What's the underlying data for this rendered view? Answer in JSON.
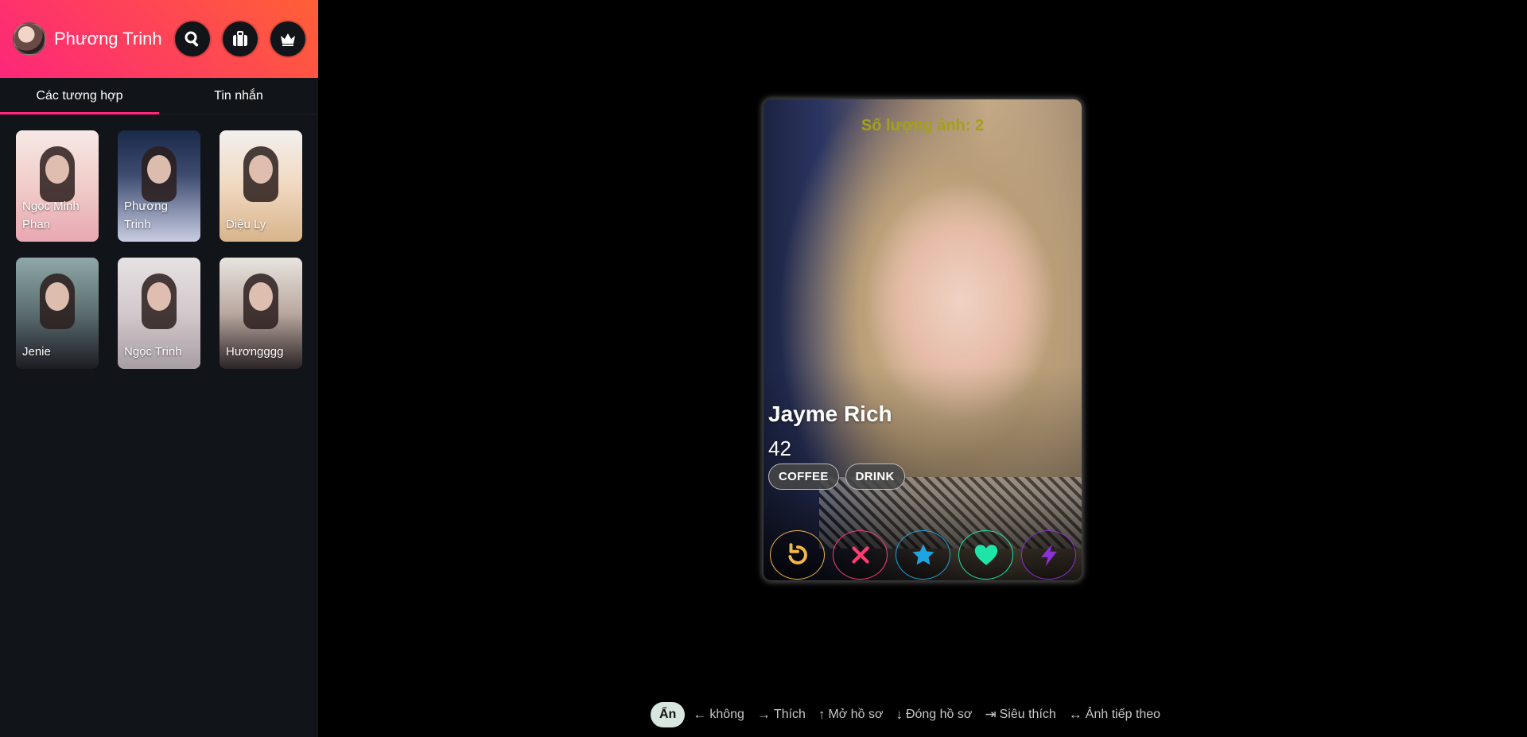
{
  "header": {
    "user_name": "Phương Trinh",
    "icons": [
      "search-icon",
      "briefcase-icon",
      "crown-icon"
    ]
  },
  "tabs": [
    {
      "label": "Các tương hợp",
      "active": true
    },
    {
      "label": "Tin nhắn",
      "active": false
    }
  ],
  "matches": [
    {
      "name": "Ngọc Minh Phan"
    },
    {
      "name": "Phương Trinh"
    },
    {
      "name": "Diệu Ly"
    },
    {
      "name": "Jenie"
    },
    {
      "name": "Ngọc Trinh"
    },
    {
      "name": "Hươngggg"
    }
  ],
  "card": {
    "photo_count": "Số lượng ảnh: 2",
    "name": "Jayme Rich",
    "age": "42",
    "tags": [
      "COFFEE",
      "DRINK"
    ],
    "actions": [
      "rewind-icon",
      "nope-icon",
      "super-like-icon",
      "like-icon",
      "boost-icon"
    ]
  },
  "hints": {
    "hide_label": "Ẩn",
    "items": [
      {
        "arrow": "←",
        "label": "không"
      },
      {
        "arrow": "→",
        "label": "Thích"
      },
      {
        "arrow": "↑",
        "label": "Mở hồ sơ"
      },
      {
        "arrow": "↓",
        "label": "Đóng hồ sơ"
      },
      {
        "arrow": "⇥",
        "label": "Siêu thích"
      },
      {
        "arrow": "↔",
        "label": "Ảnh tiếp theo"
      }
    ]
  },
  "colors": {
    "brand_start": "#fd267a",
    "brand_end": "#ff6036",
    "photo_count": "#a3a11a",
    "rewind": "#f5b748",
    "nope": "#fe3c72",
    "star": "#1ea4e0",
    "like": "#1fe4a8",
    "boost": "#8b31d6"
  }
}
